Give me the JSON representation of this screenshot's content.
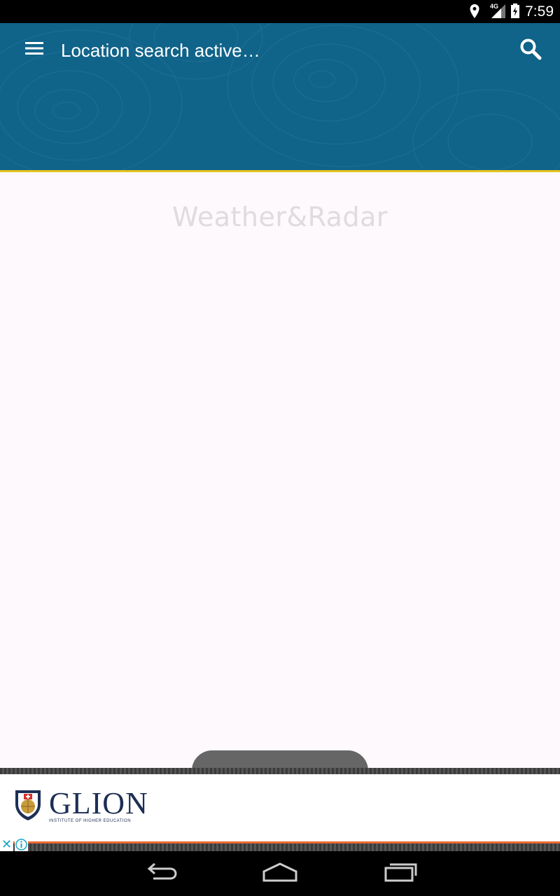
{
  "status_bar": {
    "time": "7:59",
    "network": "4G",
    "icons": [
      "location-icon",
      "signal-icon",
      "battery-icon"
    ]
  },
  "app_bar": {
    "title": "Location search active…",
    "menu_icon": "hamburger-menu-icon",
    "search_icon": "search-icon",
    "background_color": "#106389",
    "accent_color": "#e5c41d"
  },
  "main": {
    "watermark": "Weather&Radar"
  },
  "ad": {
    "brand": "GLION",
    "tagline": "INSTITUTE OF HIGHER EDUCATION",
    "close_icon": "close-icon",
    "info_icon": "info-icon"
  },
  "nav_bar": {
    "icons": [
      "back-icon",
      "home-icon",
      "recents-icon"
    ]
  }
}
